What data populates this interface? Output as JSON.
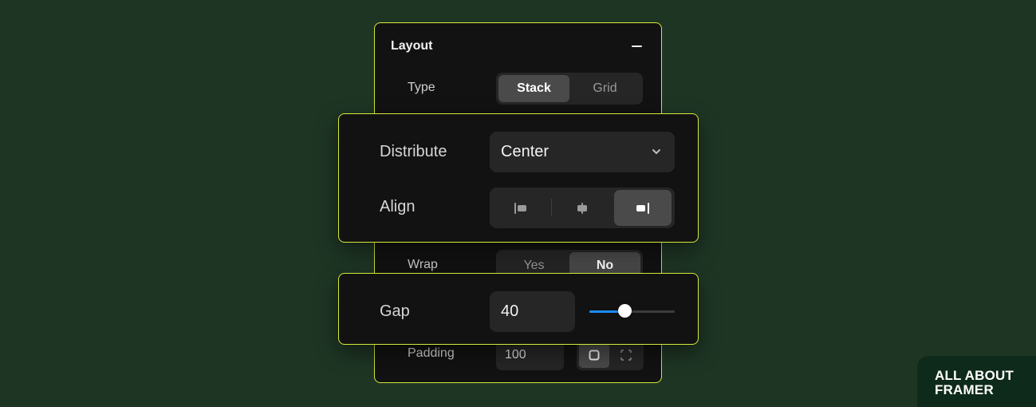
{
  "layout_panel": {
    "title": "Layout",
    "type": {
      "label": "Type",
      "options": [
        "Stack",
        "Grid"
      ],
      "selected": "Stack"
    },
    "wrap": {
      "label": "Wrap",
      "options": [
        "Yes",
        "No"
      ],
      "selected": "No"
    },
    "padding": {
      "label": "Padding",
      "value": "100"
    }
  },
  "distribute_popover": {
    "distribute": {
      "label": "Distribute",
      "value": "Center"
    },
    "align": {
      "label": "Align",
      "options": [
        "align-start-icon",
        "align-center-icon",
        "align-end-icon"
      ],
      "selected": "align-end-icon"
    }
  },
  "gap_popover": {
    "label": "Gap",
    "value": "40",
    "slider_fraction": 0.42
  },
  "brand": {
    "line1": "ALL ABOUT",
    "line2": "FRAMER"
  },
  "colors": {
    "background": "#1e3524",
    "accent_outline": "#d4ea3a",
    "slider_fill": "#1a8cff"
  }
}
